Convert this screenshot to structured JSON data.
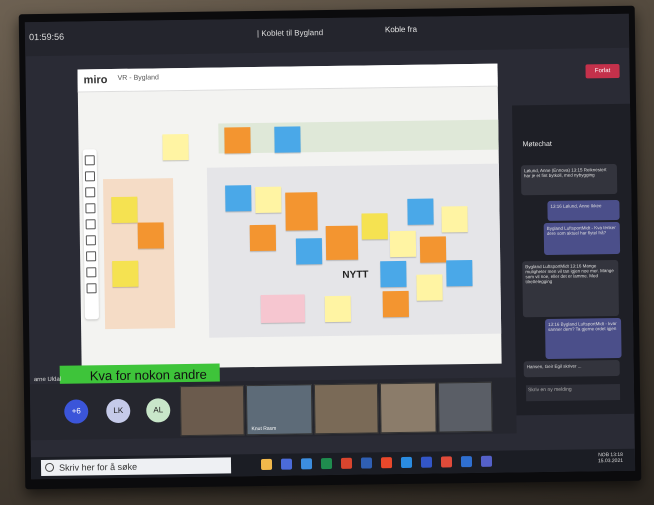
{
  "teams": {
    "clock": "01:59:56",
    "meeting_title": "| Koblet til Bygland",
    "join_label": "Koble fra",
    "leave_label": "Forlat",
    "left_name": "arne Uldal"
  },
  "miro": {
    "logo": "miro",
    "board_name": "VR - Bygland",
    "nytt_label": "NYTT"
  },
  "banner": {
    "text": "Kva for nokon andre"
  },
  "chat": {
    "title": "Møtechat",
    "messages": [
      {
        "side": "other",
        "text": "Lølund, Anne (Ennova) 13:15 Reiknestert har je et fint bytkoll, med nybygging"
      },
      {
        "side": "mine",
        "text": "13:16 Lølund, Anne Ikkee"
      },
      {
        "side": "mine",
        "text": "Bygland LuftsportMidt - Kva tenker dere som aktuel har flytel frå?"
      },
      {
        "side": "other",
        "text": "Bygland LuftsportMidt 13:16 Mange muligheter men vil tan igjen noe mer. Mange som vil noe, eller det er lamme. Med tilrettelegging"
      },
      {
        "side": "mine",
        "text": "13:16 Bygland LuftsportMidt - kvar sanner dem? Ta gjerne ordet igjen"
      },
      {
        "side": "other",
        "text": "Hansen, Geir Egil skriver ..."
      }
    ],
    "input_placeholder": "Skriv en ny melding"
  },
  "participants": {
    "overflow_count": "+6",
    "avatars": [
      {
        "initials": "LK",
        "color": "#c5cae9"
      },
      {
        "initials": "AL",
        "color": "#c8e6c9"
      }
    ],
    "video_labels": [
      "",
      "Knut Rasm",
      "",
      "",
      ""
    ]
  },
  "taskbar": {
    "search_placeholder": "Skriv her for å søke",
    "time": "13:18",
    "date": "15.03.2021",
    "lang": "NOB"
  },
  "colors": {
    "sticky_yellow": "#f5e251",
    "sticky_orange": "#f39530",
    "sticky_blue": "#4aa8e8",
    "sticky_pink": "#f6c6d0",
    "sticky_lightyellow": "#fff4a3",
    "banner_green": "#3ec43a",
    "leave_red": "#c4314b"
  }
}
